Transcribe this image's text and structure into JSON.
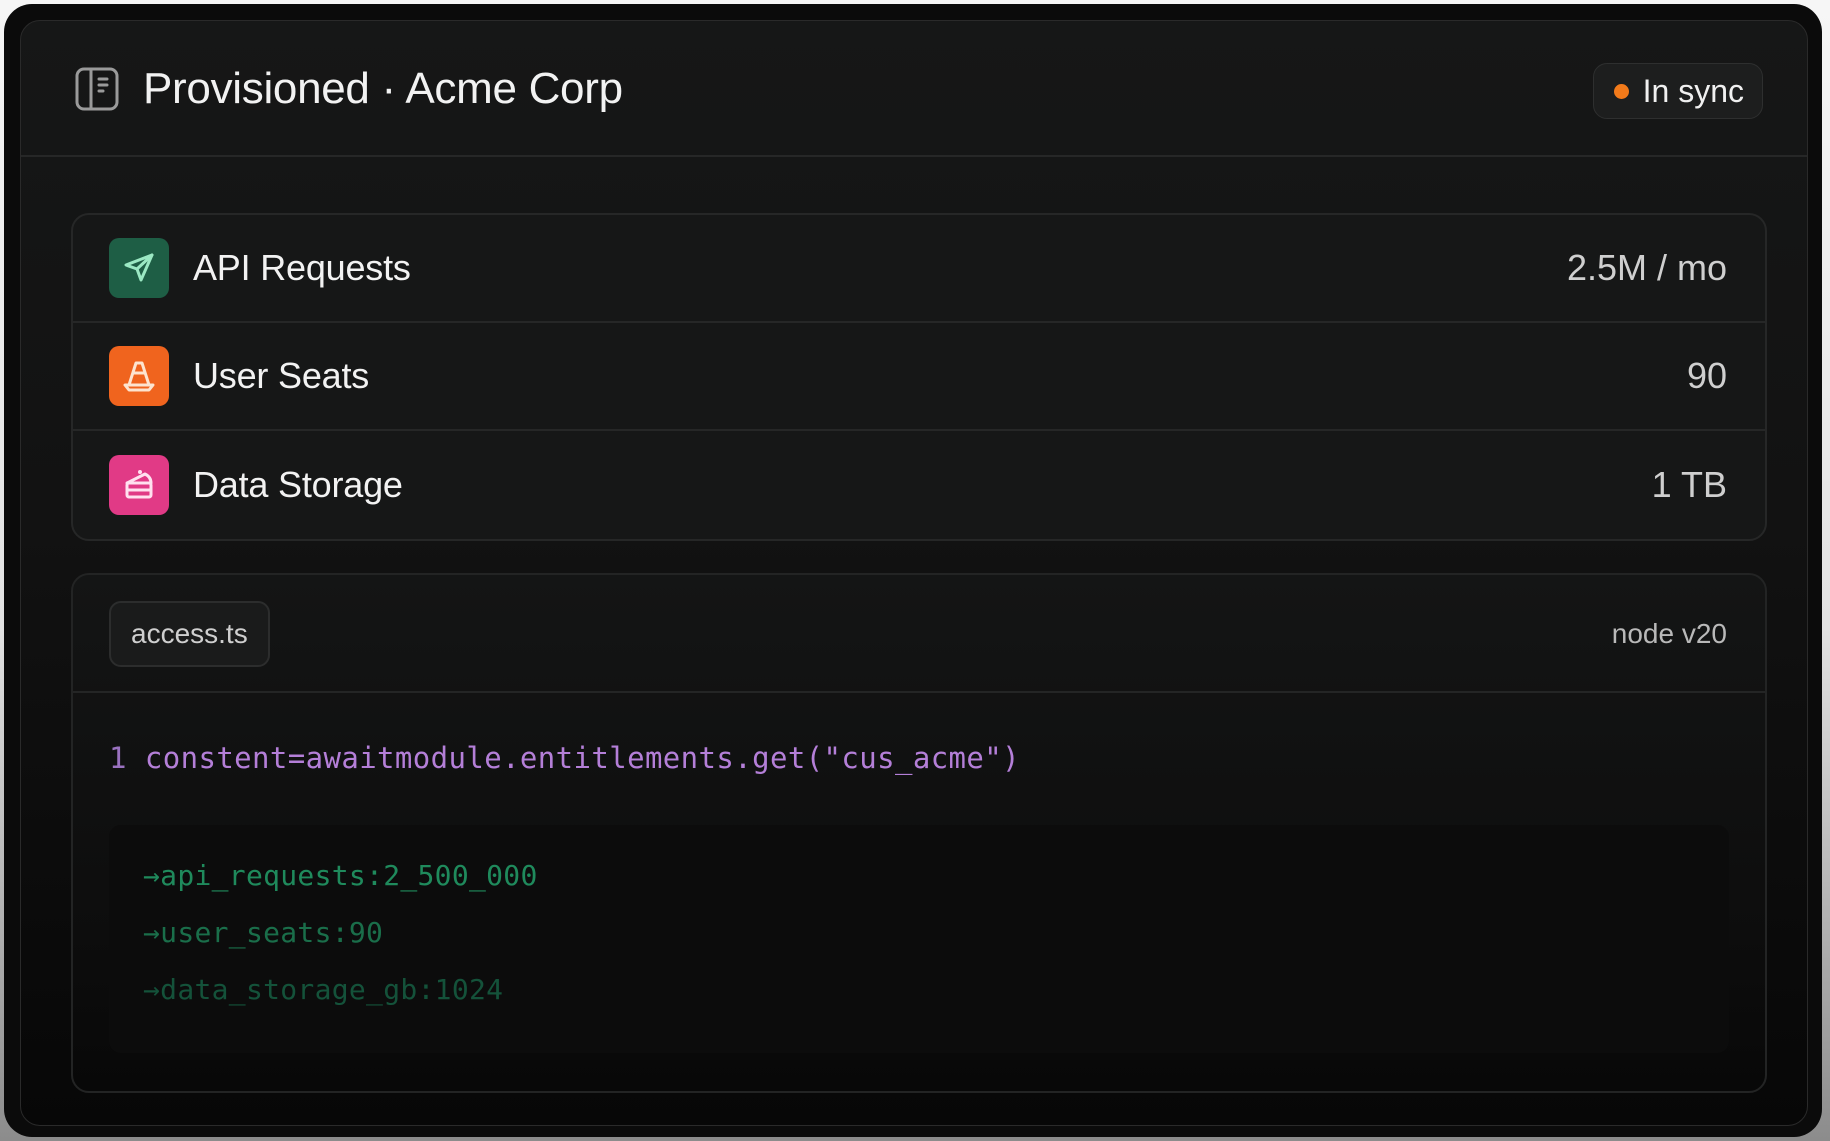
{
  "header": {
    "title": "Provisioned · Acme Corp",
    "icon": "sidebar-panel-icon",
    "status": {
      "label": "In sync",
      "color": "#f27a1a"
    }
  },
  "entitlements": [
    {
      "label": "API Requests",
      "value": "2.5M / mo",
      "icon": "send-arrow-icon",
      "color": "#1e5e45"
    },
    {
      "label": "User Seats",
      "value": "90",
      "icon": "traffic-cone-icon",
      "color": "#f0641e"
    },
    {
      "label": "Data Storage",
      "value": "1 TB",
      "icon": "cake-slice-icon",
      "color": "#e13a86"
    }
  ],
  "code": {
    "filename": "access.ts",
    "runtime": "node v20",
    "line_number": "1",
    "line": "constent=awaitmodule.entitlements.get(\"cus_acme\")",
    "output": [
      "→api_requests:2_500_000",
      "→user_seats:90",
      "→data_storage_gb:1024"
    ]
  }
}
